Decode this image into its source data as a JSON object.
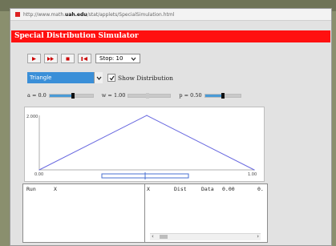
{
  "browser": {
    "url_prefix": "http://www.math.",
    "url_host": "uah.edu",
    "url_path": "/stat/applets/SpecialSimulation.html"
  },
  "app": {
    "title": "Special Distribution Simulator"
  },
  "toolbar": {
    "stop_label": "Stop: 10"
  },
  "distribution": {
    "selected": "Triangle",
    "show_distribution_label": "Show Distribution",
    "show_distribution_checked": true
  },
  "params": [
    {
      "label": "a = 0.0",
      "fraction": 0.55
    },
    {
      "label": "w = 1.00",
      "fraction": 0.45
    },
    {
      "label": "p = 0.50",
      "fraction": 0.5
    }
  ],
  "chart_data": {
    "type": "line",
    "x": [
      0,
      0.5,
      1
    ],
    "y": [
      0,
      2,
      0
    ],
    "xlim": [
      0,
      1
    ],
    "ylim": [
      0,
      2
    ],
    "x_tick_labels": [
      "0.00",
      "1.00"
    ],
    "y_tick_labels": [
      "2.000"
    ]
  },
  "tables": {
    "left_headers": [
      "Run",
      "X"
    ],
    "right_headers": [
      "X",
      "Dist",
      "Data",
      "0.00",
      "0."
    ]
  },
  "colors": {
    "title_bar": "#ff1010",
    "select_highlight": "#3a8fd8",
    "curve": "#6a6ae0",
    "slider_fill": "#4a9ad6"
  }
}
